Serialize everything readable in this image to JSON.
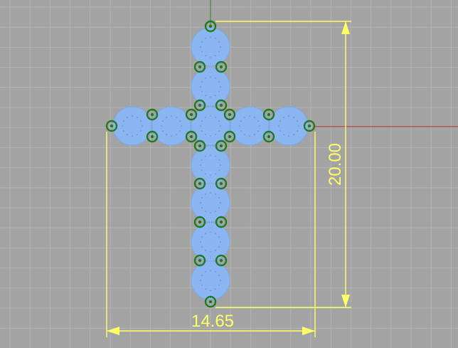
{
  "viewport": {
    "background": "#a3a3a3",
    "grid_color": "#b4b4b4",
    "x_axis_color": "#b22a2a",
    "y_axis_color": "#2a8a2a"
  },
  "object": {
    "description_name": "cross",
    "sphere_fill": "#8bb6f2",
    "sphere_stroke": "#7aa8ea",
    "control_point_color": "#1f7a1f"
  },
  "dimensions": {
    "width_value": "14.65",
    "height_value": "20.00",
    "color": "#ffff66"
  }
}
